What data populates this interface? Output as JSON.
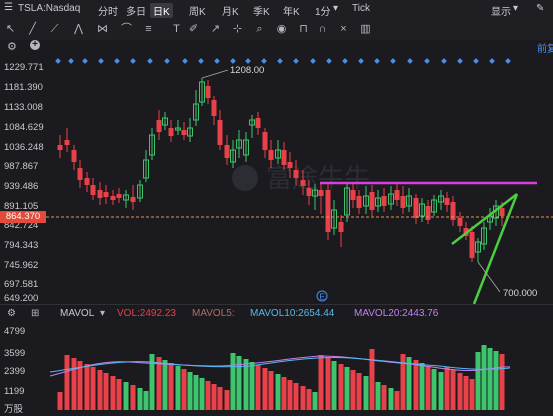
{
  "symbol": "TSLA:Nasdaq",
  "periods": [
    "分时",
    "多日",
    "日K",
    "周K",
    "月K",
    "季K",
    "年K",
    "1分",
    "Tick"
  ],
  "selected_period": "日K",
  "display_label": "显示",
  "right_label": "前复",
  "y_axis": [
    "1229.771",
    "1181.390",
    "1133.008",
    "1084.629",
    "1036.248",
    "987.867",
    "939.486",
    "891.105",
    "842.724",
    "794.343",
    "745.962",
    "697.581",
    "649.200"
  ],
  "current_price": "864.370",
  "annotations": {
    "high": "1208.00",
    "low": "700.000"
  },
  "event_marker": "E",
  "watermark": "富途牛牛",
  "volume_indicator": {
    "name": "MAVOL",
    "vol": "VOL:2492.23",
    "ma5": "MAVOL5:",
    "ma10": "MAVOL10:2654.44",
    "ma20": "MAVOL20:2443.76"
  },
  "volume_axis": [
    "4799",
    "3599",
    "2399",
    "1199"
  ],
  "volume_unit": "万股",
  "colors": {
    "up": "#3ec46d",
    "down": "#e8414a",
    "trend": "#4ccf3f",
    "resistance": "#d93fdc",
    "dot": "#4a8ef0",
    "price_line": "#e8954a"
  }
}
